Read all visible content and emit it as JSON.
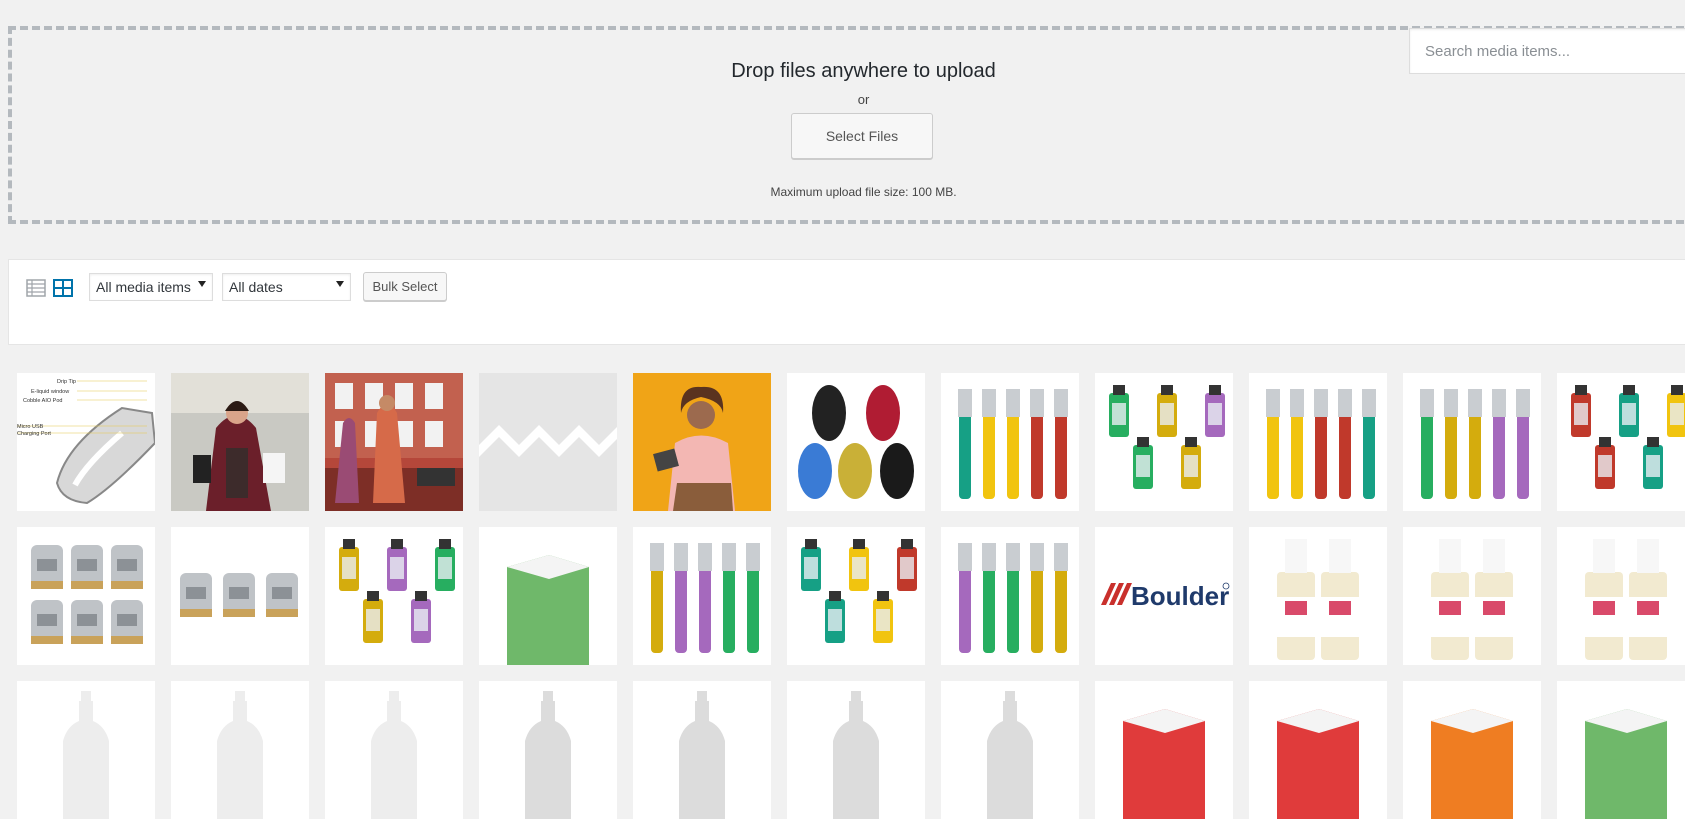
{
  "uploader": {
    "title": "Drop files anywhere to upload",
    "or_text": "or",
    "select_button": "Select Files",
    "max_size": "Maximum upload file size: 100 MB.",
    "close_glyph": "✕"
  },
  "toolbar": {
    "views": [
      {
        "name": "list-view-icon",
        "active": false
      },
      {
        "name": "grid-view-icon",
        "active": true
      }
    ],
    "type_filter": {
      "selected": "All media items"
    },
    "date_filter": {
      "selected": "All dates"
    },
    "bulk_select": "Bulk Select",
    "search": {
      "placeholder": "Search media items..."
    }
  },
  "colors": {
    "accent": "#0073aa",
    "background": "#f1f1f1",
    "border": "#b4b9be"
  },
  "media_rows": [
    [
      {
        "kind": "diagram",
        "labels": [
          "Drip Tip",
          "E-liquid window",
          "Cobble AIO Pod",
          "Micro USB",
          "Charging Port"
        ]
      },
      {
        "kind": "photo",
        "desc": "woman-shopping-bags"
      },
      {
        "kind": "photo",
        "desc": "street-fashion"
      },
      {
        "kind": "placeholder"
      },
      {
        "kind": "photo",
        "desc": "woman-yellow-background"
      },
      {
        "kind": "product",
        "desc": "oval-pods"
      },
      {
        "kind": "product",
        "desc": "mod-kits"
      },
      {
        "kind": "product",
        "desc": "tanks"
      },
      {
        "kind": "product",
        "desc": "pen-kits"
      },
      {
        "kind": "product",
        "desc": "pod-mods"
      },
      {
        "kind": "product",
        "desc": "tanks-chrome"
      }
    ],
    [
      {
        "kind": "product",
        "desc": "coils-group"
      },
      {
        "kind": "product",
        "desc": "coils-row"
      },
      {
        "kind": "product",
        "desc": "tanks-colors"
      },
      {
        "kind": "product",
        "desc": "box-mods"
      },
      {
        "kind": "product",
        "desc": "pen-sticks"
      },
      {
        "kind": "product",
        "desc": "tanks-mixed"
      },
      {
        "kind": "product",
        "desc": "pen-sticks-colors"
      },
      {
        "kind": "logo",
        "text": "Boulder"
      },
      {
        "kind": "product",
        "desc": "eliquid-bottles-1"
      },
      {
        "kind": "product",
        "desc": "eliquid-bottles-2"
      },
      {
        "kind": "product",
        "desc": "eliquid-bottles-3"
      }
    ],
    [
      {
        "kind": "product",
        "desc": "bottle-white"
      },
      {
        "kind": "product",
        "desc": "bottle-white"
      },
      {
        "kind": "product",
        "desc": "bottle-white"
      },
      {
        "kind": "product",
        "desc": "bottle-clear"
      },
      {
        "kind": "product",
        "desc": "bottle-clear"
      },
      {
        "kind": "product",
        "desc": "bottle-clear"
      },
      {
        "kind": "product",
        "desc": "bottle-clear"
      },
      {
        "kind": "product",
        "desc": "box-red"
      },
      {
        "kind": "product",
        "desc": "box-red"
      },
      {
        "kind": "product",
        "desc": "box-orange"
      },
      {
        "kind": "product",
        "desc": "box-green"
      }
    ]
  ]
}
